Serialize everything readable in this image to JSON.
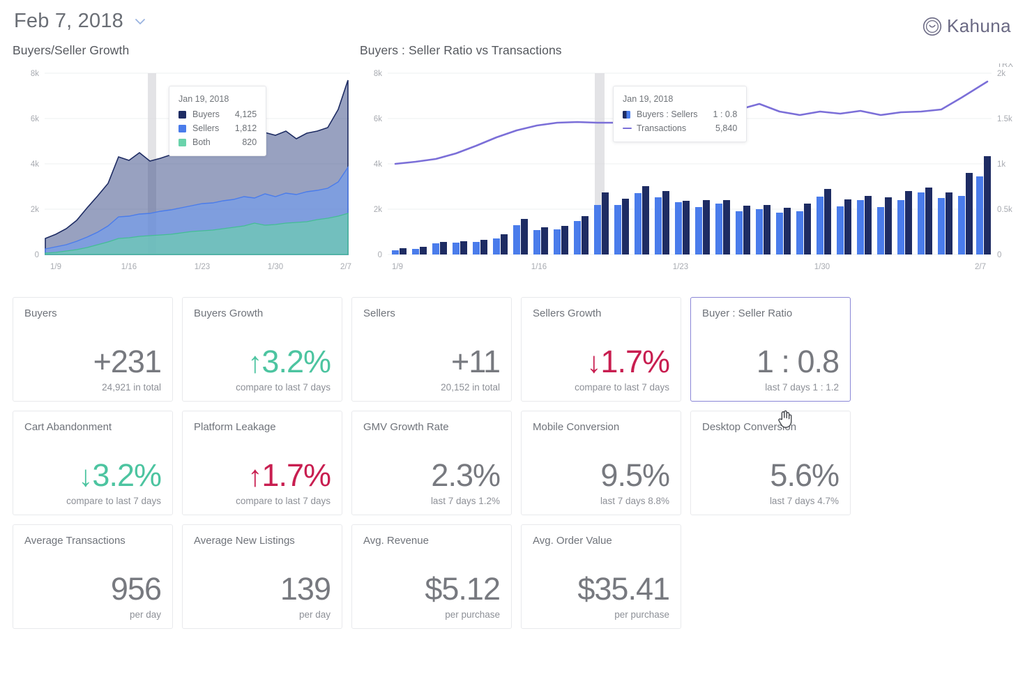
{
  "header": {
    "date_label": "Feb 7, 2018",
    "chevron_icon": "chevron-down-icon",
    "logo_text": "Kahuna",
    "logo_icon": "kahuna-circle-smile-logo"
  },
  "charts": [
    {
      "title": "Buyers/Seller Growth",
      "tooltip": {
        "date": "Jan 19, 2018",
        "rows": [
          {
            "label": "Buyers",
            "value": "4,125",
            "color": "#1e2c63"
          },
          {
            "label": "Sellers",
            "value": "1,812",
            "color": "#4a7ceb"
          },
          {
            "label": "Both",
            "value": "820",
            "color": "#6ad3ab"
          }
        ]
      }
    },
    {
      "title": "Buyers : Seller Ratio vs Transactions",
      "axis_unit": "TRX",
      "tooltip": {
        "date": "Jan 19, 2018",
        "rows": [
          {
            "label": "Buyers : Sellers",
            "value": "1 : 0.8",
            "icon": "split-swatch"
          },
          {
            "label": "Transactions",
            "value": "5,840",
            "icon": "line-dash",
            "color": "#7b6fd8"
          }
        ]
      }
    }
  ],
  "chart_data": [
    {
      "type": "area",
      "title": "Buyers/Seller Growth",
      "xlabel": "",
      "ylabel": "",
      "ylim": [
        0,
        8000
      ],
      "yticks": [
        "0",
        "2k",
        "4k",
        "6k",
        "8k"
      ],
      "xticks": [
        "1/9",
        "1/16",
        "1/23",
        "1/30",
        "2/7"
      ],
      "grid": true,
      "legend": "tooltip",
      "highlight_x": "1/19",
      "x": [
        "1/9",
        "1/10",
        "1/11",
        "1/12",
        "1/13",
        "1/14",
        "1/15",
        "1/16",
        "1/17",
        "1/18",
        "1/19",
        "1/20",
        "1/21",
        "1/22",
        "1/23",
        "1/24",
        "1/25",
        "1/26",
        "1/27",
        "1/28",
        "1/29",
        "1/30",
        "1/31",
        "2/1",
        "2/2",
        "2/3",
        "2/4",
        "2/5",
        "2/6",
        "2/7"
      ],
      "series": [
        {
          "name": "Buyers",
          "color": "#1e2c63",
          "values": [
            700,
            900,
            1150,
            1500,
            2050,
            2600,
            3150,
            4300,
            4150,
            4500,
            4125,
            4250,
            4400,
            4450,
            4500,
            4600,
            4700,
            4800,
            5000,
            5150,
            5250,
            5400,
            5250,
            5450,
            5100,
            5350,
            5450,
            5600,
            6400,
            7700
          ]
        },
        {
          "name": "Sellers",
          "color": "#4a7ceb",
          "values": [
            250,
            330,
            430,
            570,
            780,
            1000,
            1250,
            1650,
            1700,
            1790,
            1812,
            1900,
            1980,
            2050,
            2150,
            2230,
            2260,
            2380,
            2420,
            2550,
            2500,
            2680,
            2560,
            2700,
            2650,
            2760,
            2840,
            2920,
            3200,
            3850
          ]
        },
        {
          "name": "Both",
          "color": "#6ad3ab",
          "values": [
            60,
            90,
            140,
            220,
            320,
            430,
            540,
            700,
            740,
            790,
            820,
            860,
            900,
            950,
            1000,
            1050,
            1090,
            1140,
            1200,
            1260,
            1400,
            1300,
            1320,
            1380,
            1420,
            1460,
            1530,
            1600,
            1700,
            1820
          ]
        }
      ]
    },
    {
      "type": "bar+line",
      "title": "Buyers : Seller Ratio vs Transactions",
      "xlabel": "",
      "ylabel_left": "",
      "ylabel_right": "TRX",
      "ylim_left": [
        0,
        8000
      ],
      "yticks_left": [
        "0",
        "2k",
        "4k",
        "6k",
        "8k"
      ],
      "ylim_right": [
        0,
        2000
      ],
      "yticks_right": [
        "0",
        "0.5k",
        "1k",
        "1.5k",
        "2k"
      ],
      "xticks": [
        "1/9",
        "1/16",
        "1/23",
        "1/30",
        "2/7"
      ],
      "grid": true,
      "highlight_x": "1/19",
      "x": [
        "1/9",
        "1/10",
        "1/11",
        "1/12",
        "1/13",
        "1/14",
        "1/15",
        "1/16",
        "1/17",
        "1/18",
        "1/19",
        "1/20",
        "1/21",
        "1/22",
        "1/23",
        "1/24",
        "1/25",
        "1/26",
        "1/27",
        "1/28",
        "1/29",
        "1/30",
        "1/31",
        "2/1",
        "2/2",
        "2/3",
        "2/4",
        "2/5",
        "2/6",
        "2/7"
      ],
      "series": [
        {
          "name": "Sellers",
          "color": "#4a7ceb",
          "axis": "left",
          "values": [
            180,
            250,
            480,
            520,
            550,
            700,
            1280,
            1080,
            1120,
            1480,
            2200,
            2180,
            2700,
            2520,
            2300,
            2080,
            2240,
            1900,
            2000,
            1850,
            1920,
            2560,
            2100,
            2400,
            2400,
            2400,
            2350,
            2240,
            2100,
            2280
          ]
        },
        {
          "name": "Buyers",
          "color": "#1e2c63",
          "axis": "left",
          "values": [
            260,
            330,
            560,
            600,
            660,
            900,
            1560,
            1200,
            1260,
            1700,
            2750,
            2450,
            3000,
            2800,
            2350,
            2400,
            2400,
            2150,
            2180,
            2050,
            2260,
            2900,
            2450,
            2560,
            2600,
            2600,
            2600,
            2500,
            2400,
            2600
          ]
        },
        {
          "name": "Transactions",
          "color": "#7b6fd8",
          "axis": "right",
          "values": [
            1000,
            1020,
            1050,
            1110,
            1200,
            1290,
            1370,
            1430,
            1460,
            1470,
            1460,
            1455,
            1465,
            1475,
            1520,
            1560,
            1545,
            1600,
            1660,
            1580,
            1545,
            1580,
            1555,
            1590,
            1545,
            1570,
            1580,
            1600,
            1720,
            1900
          ]
        }
      ]
    }
  ],
  "kpi_cards": [
    {
      "title": "Buyers",
      "value": "+231",
      "arrow": "",
      "tone": "neutral",
      "sub": "24,921 in total",
      "active": false
    },
    {
      "title": "Buyers Growth",
      "value": "3.2%",
      "arrow": "↑",
      "tone": "up-green",
      "sub": "compare to last 7 days",
      "active": false
    },
    {
      "title": "Sellers",
      "value": "+11",
      "arrow": "",
      "tone": "neutral",
      "sub": "20,152 in total",
      "active": false
    },
    {
      "title": "Sellers Growth",
      "value": "1.7%",
      "arrow": "↓",
      "tone": "down-red",
      "sub": "compare to last 7 days",
      "active": false
    },
    {
      "title": "Buyer : Seller Ratio",
      "value": "1 : 0.8",
      "arrow": "",
      "tone": "neutral",
      "sub": "last 7 days 1 : 1.2",
      "active": true
    },
    {
      "title": "Cart Abandonment",
      "value": "3.2%",
      "arrow": "↓",
      "tone": "down-green",
      "sub": "compare to last 7 days",
      "active": false
    },
    {
      "title": "Platform Leakage",
      "value": "1.7%",
      "arrow": "↑",
      "tone": "up-red",
      "sub": "compare to last 7 days",
      "active": false
    },
    {
      "title": "GMV Growth Rate",
      "value": "2.3%",
      "arrow": "",
      "tone": "neutral",
      "sub": "last 7 days 1.2%",
      "active": false
    },
    {
      "title": "Mobile Conversion",
      "value": "9.5%",
      "arrow": "",
      "tone": "neutral",
      "sub": "last 7 days 8.8%",
      "active": false
    },
    {
      "title": "Desktop Conversion",
      "value": "5.6%",
      "arrow": "",
      "tone": "neutral",
      "sub": "last 7 days 4.7%",
      "active": false
    },
    {
      "title": "Average Transactions",
      "value": "956",
      "arrow": "",
      "tone": "neutral",
      "sub": "per day",
      "active": false
    },
    {
      "title": "Average New Listings",
      "value": "139",
      "arrow": "",
      "tone": "neutral",
      "sub": "per day",
      "active": false
    },
    {
      "title": "Avg. Revenue",
      "value": "$5.12",
      "arrow": "",
      "tone": "neutral",
      "sub": "per purchase",
      "active": false
    },
    {
      "title": "Avg. Order Value",
      "value": "$35.41",
      "arrow": "",
      "tone": "neutral",
      "sub": "per purchase",
      "active": false
    }
  ],
  "colors": {
    "buyers": "#1e2c63",
    "sellers": "#4a7ceb",
    "both": "#6ad3ab",
    "transactions": "#7b6fd8",
    "positive": "#4cc4a0",
    "negative": "#c81e50",
    "accent": "#8a86d6"
  }
}
